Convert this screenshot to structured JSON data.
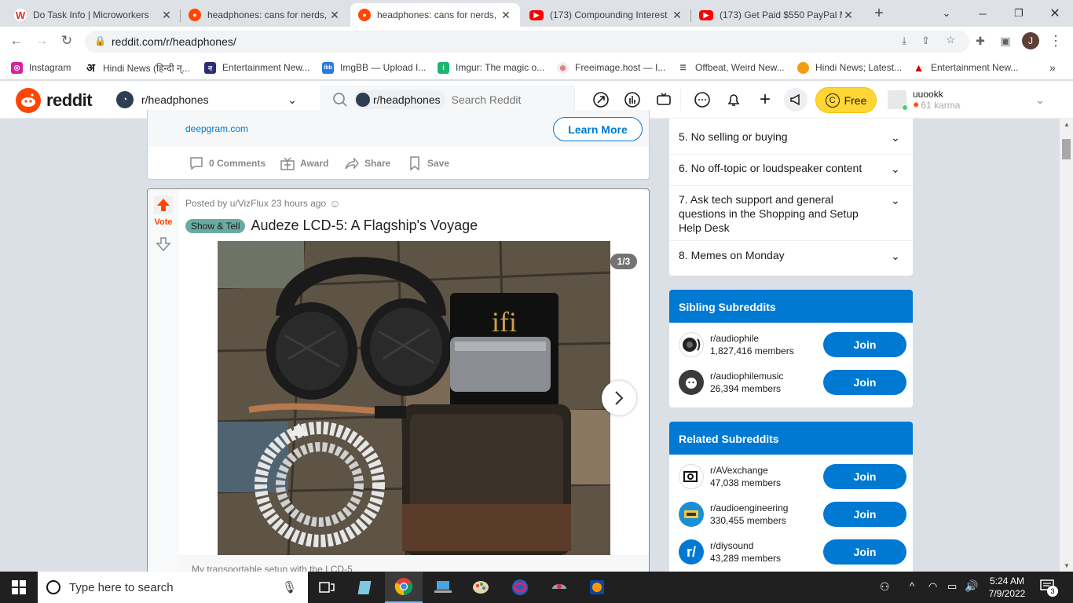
{
  "browser": {
    "tabs": [
      {
        "title": "Do Task Info | Microworkers",
        "icon": "microworkers-icon",
        "color": "#d93025"
      },
      {
        "title": "headphones: cans for nerds,",
        "icon": "reddit-icon",
        "color": "#ff4500"
      },
      {
        "title": "headphones: cans for nerds,",
        "icon": "reddit-icon",
        "color": "#ff4500"
      },
      {
        "title": "(173) Compounding Interest",
        "icon": "youtube-icon",
        "color": "#ff0000"
      },
      {
        "title": "(173) Get Paid $550 PayPal M",
        "icon": "youtube-icon",
        "color": "#ff0000"
      }
    ],
    "url": "reddit.com/r/headphones/",
    "bookmarks": [
      {
        "label": "Instagram",
        "color": "#d6249f"
      },
      {
        "label": "Hindi News (हिन्दी न्...",
        "color": "#111111"
      },
      {
        "label": "Entertainment New...",
        "color": "#2c2c7a"
      },
      {
        "label": "ImgBB — Upload I...",
        "color": "#2a7ae2"
      },
      {
        "label": "Imgur: The magic o...",
        "color": "#1bb76e"
      },
      {
        "label": "Freeimage.host — I...",
        "color": "#e57373"
      },
      {
        "label": "Offbeat, Weird New...",
        "color": "#555555"
      },
      {
        "label": "Hindi News; Latest...",
        "color": "#f39c12"
      },
      {
        "label": "Entertainment New...",
        "color": "#d50000"
      }
    ],
    "profile_initial": "J"
  },
  "reddit": {
    "logo_text": "reddit",
    "community": "r/headphones",
    "search_chip": "r/headphones",
    "search_placeholder": "Search Reddit",
    "premium_label": "Free",
    "username": "uuookk",
    "karma": "61 karma",
    "accent": "#ff4500",
    "blue": "#0079d3"
  },
  "ad": {
    "domain": "deepgram.com",
    "cta": "Learn More",
    "actions": [
      "0 Comments",
      "Award",
      "Share",
      "Save"
    ]
  },
  "post": {
    "vote_label": "Vote",
    "meta": "Posted by u/VizFlux 23 hours ago",
    "flair": "Show & Tell",
    "title": "Audeze LCD-5: A Flagship's Voyage",
    "gallery_counter": "1/3",
    "caption": "My transportable setup with the LCD-5",
    "image_brand": "ifi"
  },
  "sidebar": {
    "rules": [
      "5. No selling or buying",
      "6. No off-topic or loudspeaker content",
      "7. Ask tech support and general questions in the Shopping and Setup Help Desk",
      "8. Memes on Monday"
    ],
    "sibling_title": "Sibling Subreddits",
    "sibling": [
      {
        "name": "r/audiophile",
        "members": "1,827,416 members",
        "join": "Join"
      },
      {
        "name": "r/audiophilemusic",
        "members": "26,394 members",
        "join": "Join"
      }
    ],
    "related_title": "Related Subreddits",
    "related": [
      {
        "name": "r/AVexchange",
        "members": "47,038 members",
        "join": "Join"
      },
      {
        "name": "r/audioengineering",
        "members": "330,455 members",
        "join": "Join"
      },
      {
        "name": "r/diysound",
        "members": "43,289 members",
        "join": "Join"
      }
    ]
  },
  "taskbar": {
    "search_placeholder": "Type here to search",
    "time": "5:24 AM",
    "date": "7/9/2022",
    "notification_count": "3"
  }
}
